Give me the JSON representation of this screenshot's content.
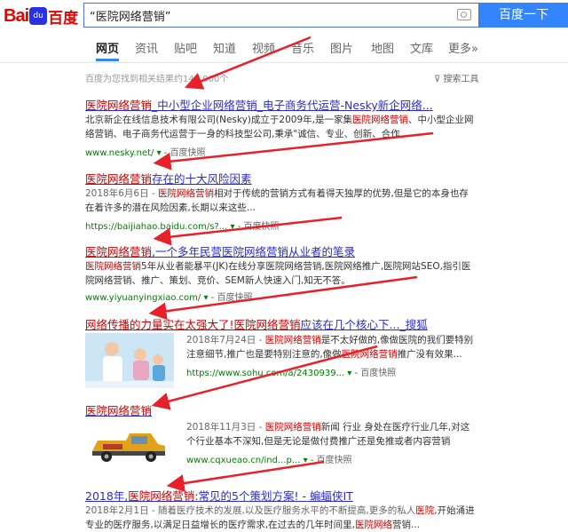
{
  "logo": {
    "bai": "Bai",
    "du": "du",
    "zh": "百度"
  },
  "search": {
    "query": "“医院网络营销”",
    "button": "百度一下"
  },
  "tabs": [
    "网页",
    "资讯",
    "贴吧",
    "知道",
    "视频",
    "音乐",
    "图片",
    "地图",
    "文库",
    "更多»"
  ],
  "result_count": "百度为您找到相关结果约143,000个",
  "tools": "搜索工具",
  "results": [
    {
      "title_pre": "",
      "title_red": "医院网络营销",
      "title_post": "_中小型企业网络营销_电子商务代运营-Nesky新企网络...",
      "lines": [
        [
          "北京新企在线信息技术有限公司(Nesky)成立于2009年,是一家集",
          "医院网络营销",
          "、中小型企业网"
        ],
        [
          "络营销、电子商务代运营于一身的科技型公司,秉承\"诚信、专业、创新、合作",
          "",
          ""
        ]
      ],
      "url": "www.nesky.net/",
      "snap": "百度快照"
    },
    {
      "title_pre": "",
      "title_red": "医院网络营销",
      "title_post": "存在的十大风险因素",
      "lines": [
        [
          "2018年6月6日 - ",
          "医院网络营销",
          "相对于传统的营销方式有着得天独厚的优势,但是它的本身也存"
        ],
        [
          "在着许多的潜在风险因素,长期以来这些...",
          "",
          ""
        ]
      ],
      "url": "https://baijiahao.baidu.com/s?...",
      "snap": "百度快照"
    },
    {
      "title_pre": "",
      "title_red": "医院网络营销",
      "title_post": ",一个多年民营医院网络营销从业者的笔录",
      "lines": [
        [
          "",
          "医院网络营销",
          "5年从业者能暴平(JK)在线分享医院网络营销,医院网络推广,医院网站SEO,指引医"
        ],
        [
          "院网络营销、推广、策划、竞价、SEM新人快速入门,知无不答。",
          "",
          ""
        ]
      ],
      "url": "www.yiyuanyingxiao.com/",
      "snap": "百度快照"
    },
    {
      "title_pre": "网络传播的力量实在太强大了!",
      "title_red": "医院网络营销",
      "title_post": "应该在几个核心下..._搜狐",
      "lines": [
        [
          "2018年7月24日 - ",
          "医院网络营销",
          "是不太好做的,像做医院的我们要特别"
        ],
        [
          "注意细节,推广也是要特别注意的,像做",
          "医院网络营销",
          "推广没有效果..."
        ]
      ],
      "url": "https://www.sohu.com/a/2430939...",
      "snap": "百度快照"
    },
    {
      "title_pre": "",
      "title_red": "医院网络营销",
      "title_post": "",
      "lines": [
        [
          "2018年11月3日 - ",
          "医院网络营销",
          "新闻 行业 身处在医疗行业几年,对这"
        ],
        [
          "个行业基本不深知,但是无论是做付费推广还是免推或者内容营销",
          "",
          ""
        ]
      ],
      "url": "www.cqxueao.cn/ind...p...",
      "snap": "百度快照"
    },
    {
      "title_pre": "2018年,",
      "title_red": "医院网络营销",
      "title_post": ":常见的5个策划方案! - 蝙蝠侠IT",
      "lines": [
        [
          "2018年2月1日 - 随着医疗技术的发展,以及医疗服务水平的不断提高,更多的私人",
          "医院",
          ",开始涌进"
        ],
        [
          "专业的医疗服务,以满足日益增长的医疗需求,在过去的几年时间里,",
          "医院网络",
          "营销..."
        ]
      ],
      "url": "",
      "snap": ""
    }
  ],
  "colors": {
    "link": "#2b2bd3",
    "highlight": "#c00000",
    "url": "#008000",
    "arrow": "#e8202a",
    "button": "#3385ff"
  }
}
